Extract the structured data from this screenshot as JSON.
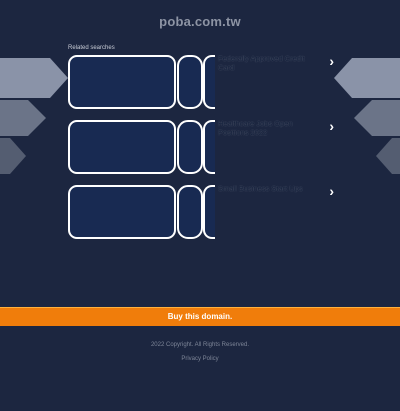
{
  "header": {
    "domain": "poba.com.tw"
  },
  "related": {
    "heading": "Related searches",
    "items": [
      {
        "label": "Federally Approved Credit Card",
        "chevron": "chevron-right-icon"
      },
      {
        "label": "Healthcare Jobs Open Positions 2022",
        "chevron": "chevron-right-icon"
      },
      {
        "label": "Small Business Start Ups",
        "chevron": "chevron-right-icon"
      }
    ]
  },
  "cta": {
    "label": "Buy this domain."
  },
  "footer": {
    "copyright": "2022 Copyright. All Rights Reserved.",
    "privacy": "Privacy Policy"
  },
  "colors": {
    "background": "#1c2640",
    "accent": "#f07d0b",
    "button_fill": "#182a52"
  }
}
